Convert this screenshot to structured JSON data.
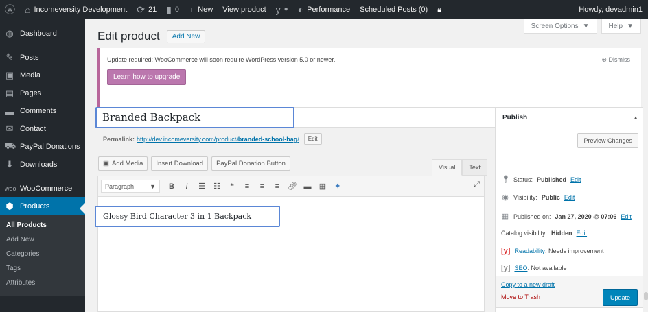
{
  "adminbar": {
    "site_name": "Incomeversity Development",
    "updates_count": "21",
    "comments_count": "0",
    "new_label": "New",
    "view_product_label": "View product",
    "performance_label": "Performance",
    "scheduled_posts_label": "Scheduled Posts (0)",
    "howdy": "Howdy, devadmin1"
  },
  "sidebar": {
    "items": [
      {
        "label": "Dashboard",
        "icon": "dashboard-icon"
      },
      {
        "label": "Posts",
        "icon": "pin-icon"
      },
      {
        "label": "Media",
        "icon": "media-icon"
      },
      {
        "label": "Pages",
        "icon": "pages-icon"
      },
      {
        "label": "Comments",
        "icon": "comment-icon"
      },
      {
        "label": "Contact",
        "icon": "mail-icon"
      },
      {
        "label": "PayPal Donations",
        "icon": "cart-icon"
      },
      {
        "label": "Downloads",
        "icon": "download-icon"
      },
      {
        "label": "WooCommerce",
        "icon": "woo-icon"
      },
      {
        "label": "Products",
        "icon": "box-icon"
      }
    ],
    "submenu": [
      "All Products",
      "Add New",
      "Categories",
      "Tags",
      "Attributes"
    ]
  },
  "header": {
    "screen_options": "Screen Options",
    "help": "Help",
    "title": "Edit product",
    "add_new": "Add New"
  },
  "notice": {
    "text": "Update required: WooCommerce will soon require WordPress version 5.0 or newer.",
    "button": "Learn how to upgrade",
    "dismiss": "Dismiss"
  },
  "post": {
    "title": "Branded Backpack",
    "permalink_label": "Permalink:",
    "permalink_base": "http://dev.incomeversity.com/product/",
    "permalink_slug": "branded-school-bag",
    "permalink_end": "/",
    "edit_label": "Edit",
    "content": "Glossy Bird Character 3 in 1 Backpack"
  },
  "editor": {
    "add_media": "Add Media",
    "insert_download": "Insert Download",
    "paypal_button": "PayPal Donation Button",
    "tab_visual": "Visual",
    "tab_text": "Text",
    "format": "Paragraph"
  },
  "publish": {
    "title": "Publish",
    "preview": "Preview Changes",
    "status_label": "Status:",
    "status_value": "Published",
    "visibility_label": "Visibility:",
    "visibility_value": "Public",
    "published_label": "Published on:",
    "published_value": "Jan 27, 2020 @ 07:06",
    "catalog_label": "Catalog visibility:",
    "catalog_value": "Hidden",
    "edit": "Edit",
    "readability_label": "Readability",
    "readability_value": ": Needs improvement",
    "seo_label": "SEO",
    "seo_value": ": Not available",
    "copy_draft": "Copy to a new draft",
    "trash": "Move to Trash",
    "update": "Update"
  },
  "colors": {
    "accent": "#0073aa",
    "woo_purple": "#bb77ae",
    "adminbar": "#23282d"
  }
}
